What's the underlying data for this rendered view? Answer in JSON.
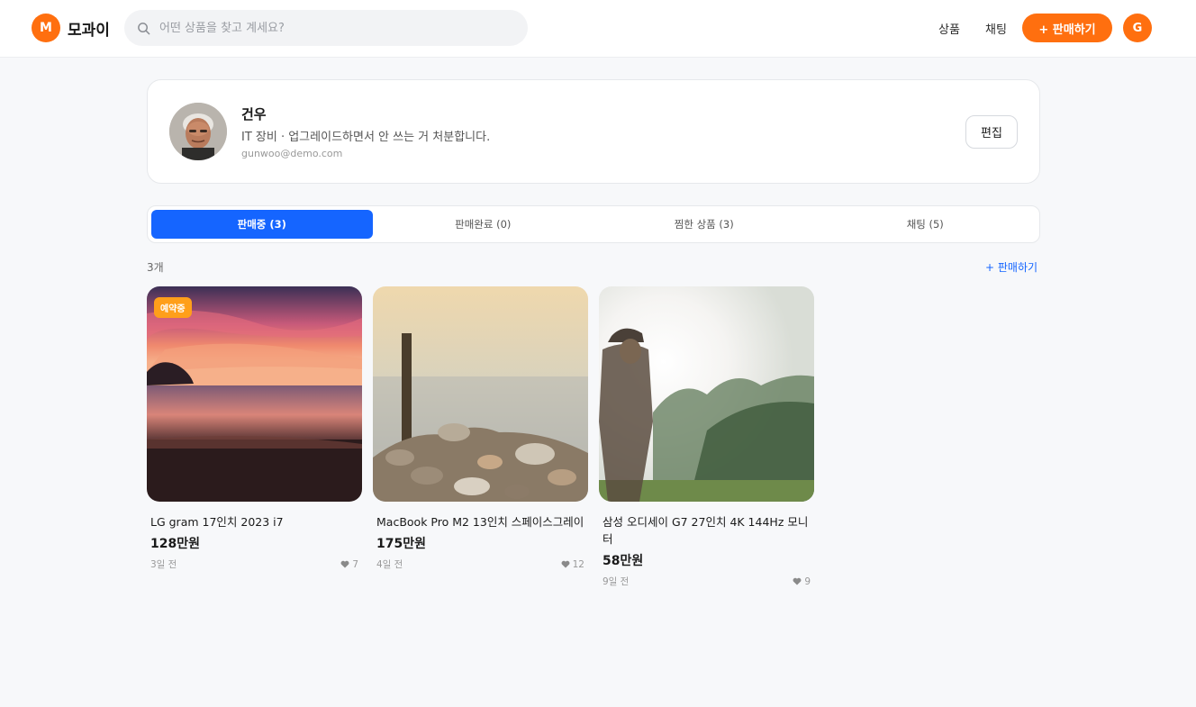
{
  "header": {
    "logo_letter": "M",
    "logo_text": "모과이",
    "search_placeholder": "어떤 상품을 찾고 계세요?",
    "nav_products": "상품",
    "nav_chat": "채팅",
    "sell_button": "+ 판매하기",
    "avatar_letter": "G"
  },
  "profile": {
    "name": "건우",
    "bio": "IT 장비 · 업그레이드하면서 안 쓰는 거 처분합니다.",
    "email": "gunwoo@demo.com",
    "edit_button": "편집"
  },
  "tabs": [
    {
      "label": "판매중 (3)",
      "active": true
    },
    {
      "label": "판매완료 (0)",
      "active": false
    },
    {
      "label": "찜한 상품 (3)",
      "active": false
    },
    {
      "label": "채팅 (5)",
      "active": false
    }
  ],
  "list": {
    "count": "3개",
    "sell_link": "+ 판매하기"
  },
  "products": [
    {
      "title": "LG gram 17인치 2023 i7",
      "price": "128만원",
      "time": "3일 전",
      "likes": "7",
      "badge": "예약중"
    },
    {
      "title": "MacBook Pro M2 13인치 스페이스그레이",
      "price": "175만원",
      "time": "4일 전",
      "likes": "12"
    },
    {
      "title": "삼성 오디세이 G7 27인치 4K 144Hz 모니터",
      "price": "58만원",
      "time": "9일 전",
      "likes": "9"
    }
  ],
  "colors": {
    "brand": "#ff6f0f",
    "tab_active": "#1565ff",
    "badge": "#ff9f1a"
  }
}
